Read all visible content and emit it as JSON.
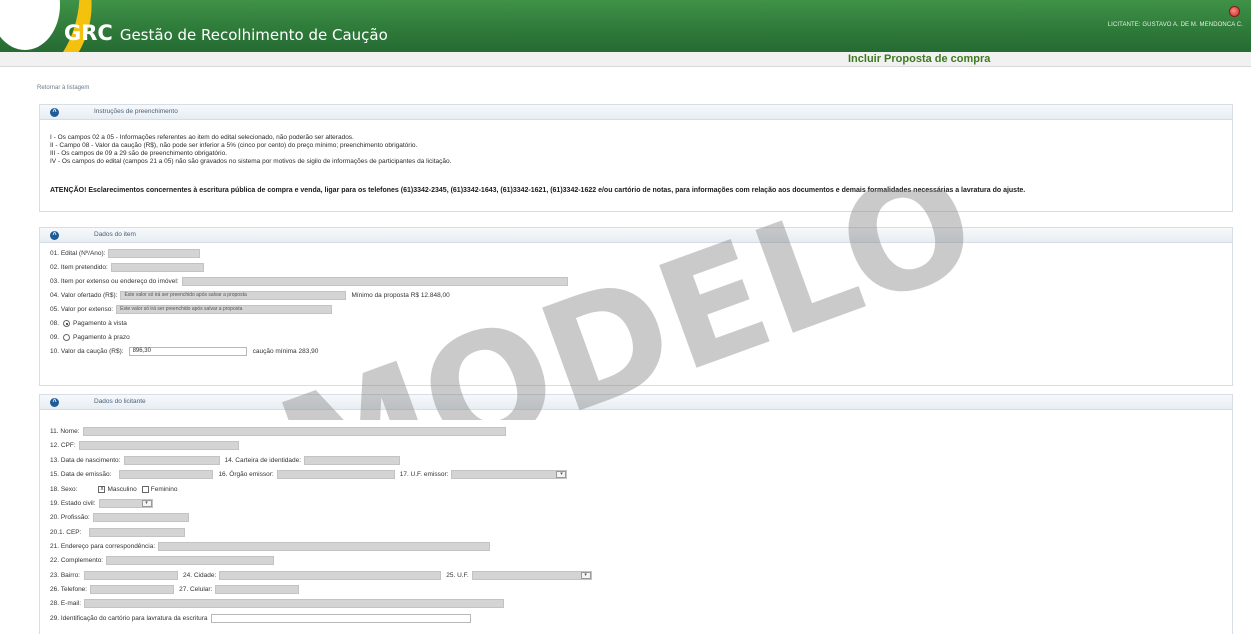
{
  "header": {
    "logo_bold": "GRC",
    "logo_text": "Gestão de Recolhimento de Caução",
    "user_text": "LICITANTE: GUSTAVO A. DE M. MENDONCA C.",
    "logout_icon": "power-icon"
  },
  "page_title": "Incluir Proposta de compra",
  "back_link": "Retornar à listagem",
  "instructions": {
    "title": "Instruções de preenchimento",
    "lines": [
      "I - Os campos 02 a 05 - Informações referentes ao item do edital selecionado, não poderão ser alterados.",
      "II - Campo 08 - Valor da caução (R$), não pode ser inferior a 5% (cinco por cento) do preço mínimo; preenchimento obrigatório.",
      "III - Os campos de 09 a 29 são de preenchimento obrigatório.",
      "IV - Os campos do edital (campos 21 a 05) não são gravados no sistema por motivos de sigilo de informações de participantes da licitação."
    ],
    "attention": "ATENÇÃO! Esclarecimentos concernentes à escritura pública de compra e venda, ligar para os telefones (61)3342-2345, (61)3342-1643, (61)3342-1621, (61)3342-1622 e/ou cartório de notas, para informações com relação aos documentos e demais formalidades necessárias a lavratura do ajuste."
  },
  "item": {
    "title": "Dados do item",
    "f01": "01. Edital (Nº/Ano):",
    "f02": "02. Item pretendido:",
    "f03": "03. Item por extenso ou endereço do imóvel:",
    "f04": "04. Valor ofertado (R$):",
    "f04_value": "Este valor só irá ser preenchido após salvar a proposta",
    "f04_min": "Mínimo da proposta R$ 12.848,00",
    "f05": "05. Valor por extenso:",
    "f05_value": "Este valor só irá ser preenchido após salvar a proposta",
    "f08": "08.",
    "f08_option": "Pagamento à vista",
    "f09": "09.",
    "f09_option": "Pagamento à prazo",
    "f10": "10. Valor da caução (R$):",
    "f10_value": "896,30",
    "f10_min": "caução mínima 283,90"
  },
  "bidder": {
    "title": "Dados do licitante",
    "f11": "11. Nome:",
    "f12": "12. CPF:",
    "f13": "13. Data de nascimento:",
    "f14": "14. Carteira de identidade:",
    "f15": "15. Data de emissão:",
    "f16": "16. Órgão emissor:",
    "f17": "17. U.F. emissor:",
    "f18": "18. Sexo:",
    "f18_opt1": "Masculino",
    "f18_opt2": "Feminino",
    "f19": "19. Estado civil:",
    "f20": "20. Profissão:",
    "f201": "20.1. CEP:",
    "f21": "21. Endereço para correspondência:",
    "f22": "22. Complemento:",
    "f23": "23. Bairro:",
    "f24": "24. Cidade:",
    "f25": "25. U.F.",
    "f26": "26. Telefone:",
    "f27": "27. Celular:",
    "f28": "28. E-mail:",
    "f29": "29. Identificação do cartório para lavratura da escritura"
  },
  "watermark": "MODELO",
  "colors": {
    "header_green": "#2f7b3a",
    "accent_yellow": "#f4c20e",
    "title_green": "#3d7a1f",
    "toggle_blue": "#1f5a99"
  }
}
